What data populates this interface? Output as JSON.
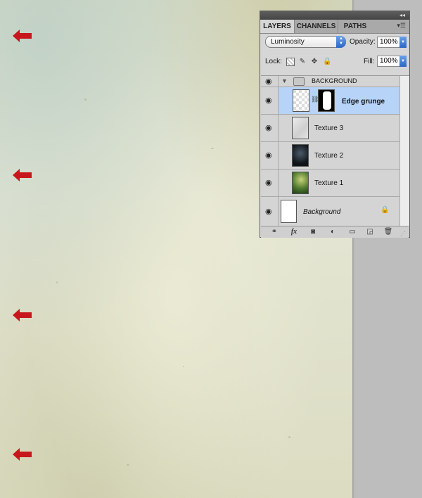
{
  "panel": {
    "tabs": [
      "LAYERS",
      "CHANNELS",
      "PATHS"
    ],
    "blend_mode": "Luminosity",
    "opacity_label": "Opacity:",
    "opacity_value": "100%",
    "lock_label": "Lock:",
    "fill_label": "Fill:",
    "fill_value": "100%",
    "layers": [
      {
        "name": "BACKGROUND",
        "type": "group"
      },
      {
        "name": "Edge grunge",
        "selected": true
      },
      {
        "name": "Texture 3"
      },
      {
        "name": "Texture 2"
      },
      {
        "name": "Texture 1"
      },
      {
        "name": "Background",
        "locked": true
      }
    ],
    "footer_icons": [
      "link-layers-icon",
      "fx-icon",
      "layer-mask-icon",
      "adjustment-layer-icon",
      "new-group-icon",
      "new-layer-icon",
      "trash-icon"
    ]
  },
  "canvas": {
    "accent_color": "#c8161d",
    "marker_icons": [
      "left-arrow-icon",
      "left-arrow-icon",
      "left-arrow-icon",
      "left-arrow-icon"
    ]
  }
}
